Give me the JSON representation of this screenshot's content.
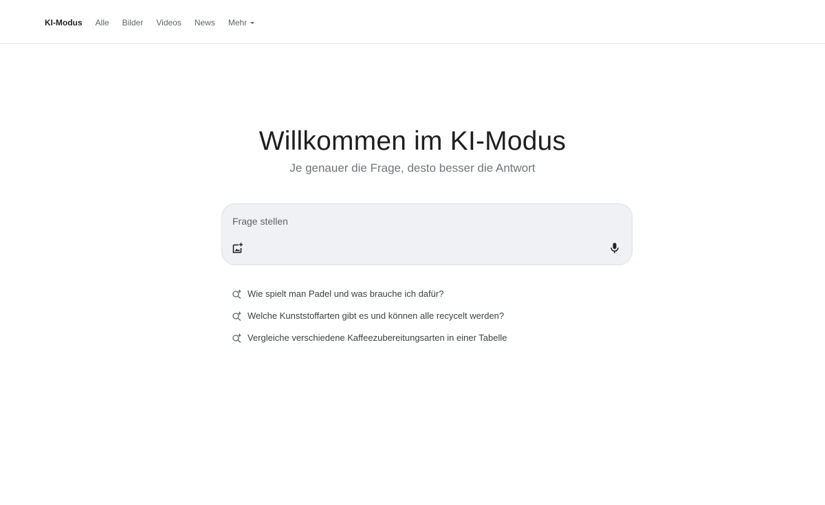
{
  "nav": {
    "tabs": [
      {
        "label": "KI-Modus",
        "active": true
      },
      {
        "label": "Alle"
      },
      {
        "label": "Bilder"
      },
      {
        "label": "Videos"
      },
      {
        "label": "News"
      }
    ],
    "more_label": "Mehr"
  },
  "hero": {
    "title": "Willkommen im KI-Modus",
    "subtitle": "Je genauer die Frage, desto besser die Antwort"
  },
  "search": {
    "placeholder": "Frage stellen",
    "value": "",
    "image_icon": "image-upload-icon",
    "mic_icon": "microphone-icon"
  },
  "suggestions": [
    {
      "text": "Wie spielt man Padel und was brauche ich dafür?",
      "icon": "search-sparkle-icon"
    },
    {
      "text": "Welche Kunststoffarten gibt es und können alle recycelt werden?",
      "icon": "search-sparkle-icon"
    },
    {
      "text": "Vergleiche verschiedene Kaffeezubereitungsarten in einer Tabelle",
      "icon": "search-sparkle-icon"
    }
  ],
  "colors": {
    "searchbox_bg": "#f0f1f5",
    "text_primary": "#1f1f1f",
    "text_secondary": "#70757a"
  }
}
